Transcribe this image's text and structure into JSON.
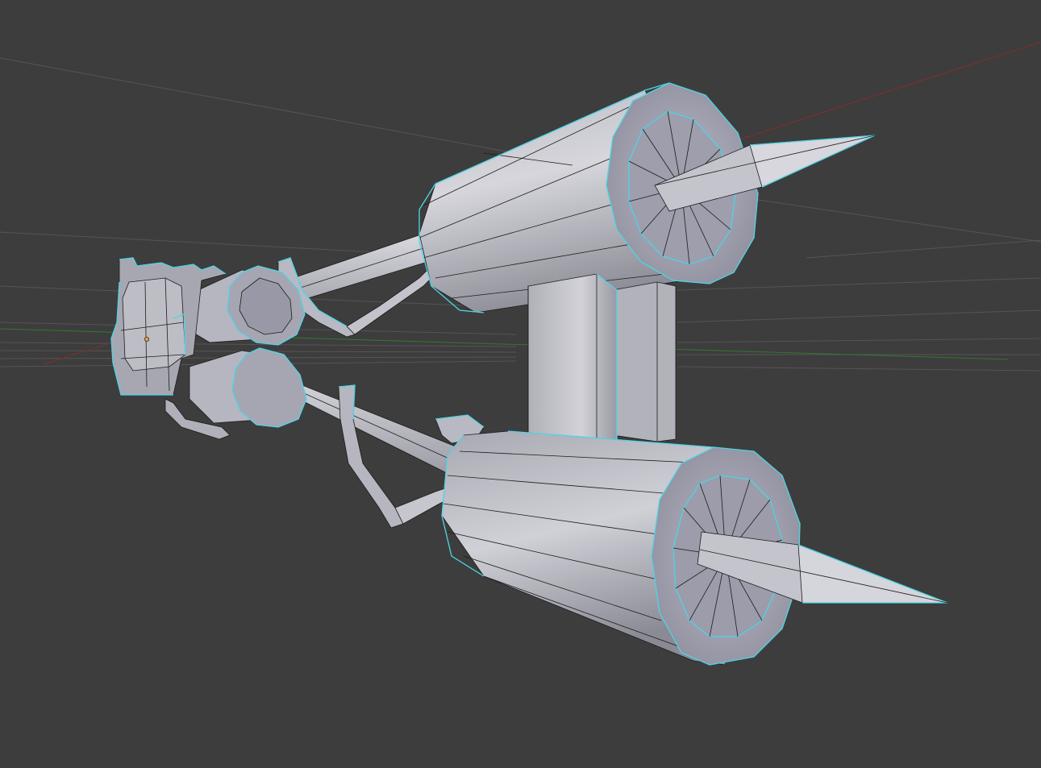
{
  "viewport": {
    "background": "#3d3d3d",
    "grid_color": "#555555",
    "x_axis_color": "#8a2b2b",
    "y_axis_color": "#2f7a2f",
    "selection_outline_color": "#4fd6e8",
    "wire_color": "#1c1c1c",
    "surface_light": "#cfcfd6",
    "surface_mid": "#a9a9b3",
    "surface_dark": "#7f7f8a",
    "origin_color": "#e8a13a"
  },
  "icons": [
    "object-origin-icon"
  ]
}
